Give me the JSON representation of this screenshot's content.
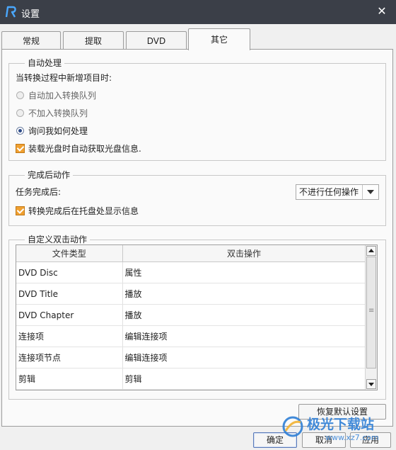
{
  "window": {
    "title": "设置",
    "close_glyph": "✕"
  },
  "tabs": [
    {
      "label": "常规",
      "active": false
    },
    {
      "label": "提取",
      "active": false
    },
    {
      "label": "DVD",
      "active": false
    },
    {
      "label": "其它",
      "active": true
    }
  ],
  "auto_process": {
    "legend": "自动处理",
    "prompt": "当转换过程中新增项目时:",
    "options": [
      {
        "label": "自动加入转换队列",
        "checked": false
      },
      {
        "label": "不加入转换队列",
        "checked": false
      },
      {
        "label": "询问我如何处理",
        "checked": true
      }
    ],
    "load_disc_label": "装载光盘时自动获取光盘信息."
  },
  "after_complete": {
    "legend": "完成后动作",
    "task_label": "任务完成后:",
    "action_value": "不进行任何操作",
    "tray_label": "转换完成后在托盘处显示信息"
  },
  "double_click": {
    "legend": "自定义双击动作",
    "columns": [
      "文件类型",
      "双击操作"
    ],
    "rows": [
      [
        "DVD Disc",
        "属性"
      ],
      [
        "DVD Title",
        "播放"
      ],
      [
        "DVD Chapter",
        "播放"
      ],
      [
        "连接项",
        "编辑连接项"
      ],
      [
        "连接项节点",
        "编辑连接项"
      ],
      [
        "剪辑",
        "剪辑"
      ]
    ]
  },
  "buttons": {
    "restore": "恢复默认设置",
    "ok": "确定",
    "cancel": "取消",
    "apply": "应用"
  },
  "watermark": {
    "name": "极光下载站",
    "url": "www.xz7.com"
  },
  "colors": {
    "titlebar": "#3b3f48",
    "checkbox_accent": "#f0a030",
    "watermark_blue": "#2f7fd6"
  }
}
